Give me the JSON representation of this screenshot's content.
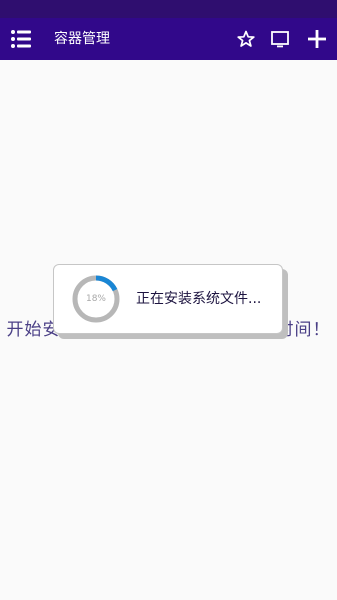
{
  "app_bar": {
    "title": "容器管理",
    "icons": [
      "menu-list-icon",
      "star-outline-icon",
      "monitor-icon",
      "add-icon"
    ]
  },
  "main": {
    "background_message": "开始安装系统，这可能需要几分钟时间！"
  },
  "loading_dialog": {
    "progress_label": "18%",
    "progress_value": 18,
    "message": "正在安装系统文件..."
  },
  "colors": {
    "app_bar": "#31088a",
    "status_bar": "#2f0e6f",
    "progress_accent": "#1a86d4",
    "progress_track": "#b7b7b7"
  }
}
